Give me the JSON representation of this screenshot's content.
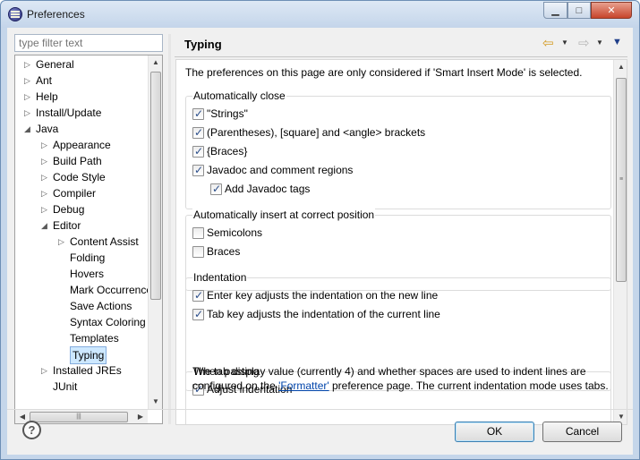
{
  "window": {
    "title": "Preferences"
  },
  "filter": {
    "placeholder": "type filter text"
  },
  "tree": [
    {
      "label": "General",
      "level": 0,
      "arrow": "▷",
      "selected": false
    },
    {
      "label": "Ant",
      "level": 0,
      "arrow": "▷",
      "selected": false
    },
    {
      "label": "Help",
      "level": 0,
      "arrow": "▷",
      "selected": false
    },
    {
      "label": "Install/Update",
      "level": 0,
      "arrow": "▷",
      "selected": false
    },
    {
      "label": "Java",
      "level": 0,
      "arrow": "◢",
      "selected": false
    },
    {
      "label": "Appearance",
      "level": 1,
      "arrow": "▷",
      "selected": false
    },
    {
      "label": "Build Path",
      "level": 1,
      "arrow": "▷",
      "selected": false
    },
    {
      "label": "Code Style",
      "level": 1,
      "arrow": "▷",
      "selected": false
    },
    {
      "label": "Compiler",
      "level": 1,
      "arrow": "▷",
      "selected": false
    },
    {
      "label": "Debug",
      "level": 1,
      "arrow": "▷",
      "selected": false
    },
    {
      "label": "Editor",
      "level": 1,
      "arrow": "◢",
      "selected": false
    },
    {
      "label": "Content Assist",
      "level": 2,
      "arrow": "▷",
      "selected": false
    },
    {
      "label": "Folding",
      "level": 2,
      "arrow": "",
      "selected": false
    },
    {
      "label": "Hovers",
      "level": 2,
      "arrow": "",
      "selected": false
    },
    {
      "label": "Mark Occurrences",
      "level": 2,
      "arrow": "",
      "selected": false
    },
    {
      "label": "Save Actions",
      "level": 2,
      "arrow": "",
      "selected": false
    },
    {
      "label": "Syntax Coloring",
      "level": 2,
      "arrow": "",
      "selected": false
    },
    {
      "label": "Templates",
      "level": 2,
      "arrow": "",
      "selected": false
    },
    {
      "label": "Typing",
      "level": 2,
      "arrow": "",
      "selected": true
    },
    {
      "label": "Installed JREs",
      "level": 1,
      "arrow": "▷",
      "selected": false
    },
    {
      "label": "JUnit",
      "level": 1,
      "arrow": "",
      "selected": false
    }
  ],
  "page": {
    "title": "Typing",
    "intro": "The preferences on this page are only considered if 'Smart Insert Mode' is selected."
  },
  "groups": {
    "auto_close": {
      "title": "Automatically close",
      "items": [
        {
          "label": "\"Strings\"",
          "checked": true
        },
        {
          "label": "(Parentheses), [square] and <angle> brackets",
          "checked": true
        },
        {
          "label": "{Braces}",
          "checked": true
        },
        {
          "label": "Javadoc and comment regions",
          "checked": true
        },
        {
          "label": "Add Javadoc tags",
          "checked": true
        }
      ]
    },
    "auto_insert": {
      "title": "Automatically insert at correct position",
      "items": [
        {
          "label": "Semicolons",
          "checked": false
        },
        {
          "label": "Braces",
          "checked": false
        }
      ]
    },
    "indentation": {
      "title": "Indentation",
      "items": [
        {
          "label": "Enter key adjusts the indentation on the new line",
          "checked": true
        },
        {
          "label": "Tab key adjusts the indentation of the current line",
          "checked": true
        }
      ],
      "note_before": "The tab display value (currently 4) and whether spaces are used to indent lines are configured on the ",
      "note_link": "'Formatter'",
      "note_after": " preference page. The current indentation mode uses tabs."
    },
    "pasting": {
      "title": "When pasting",
      "items": [
        {
          "label": "Adjust indentation",
          "checked": true
        }
      ]
    }
  },
  "footer": {
    "help_label": "?",
    "ok_label": "OK",
    "cancel_label": "Cancel"
  }
}
